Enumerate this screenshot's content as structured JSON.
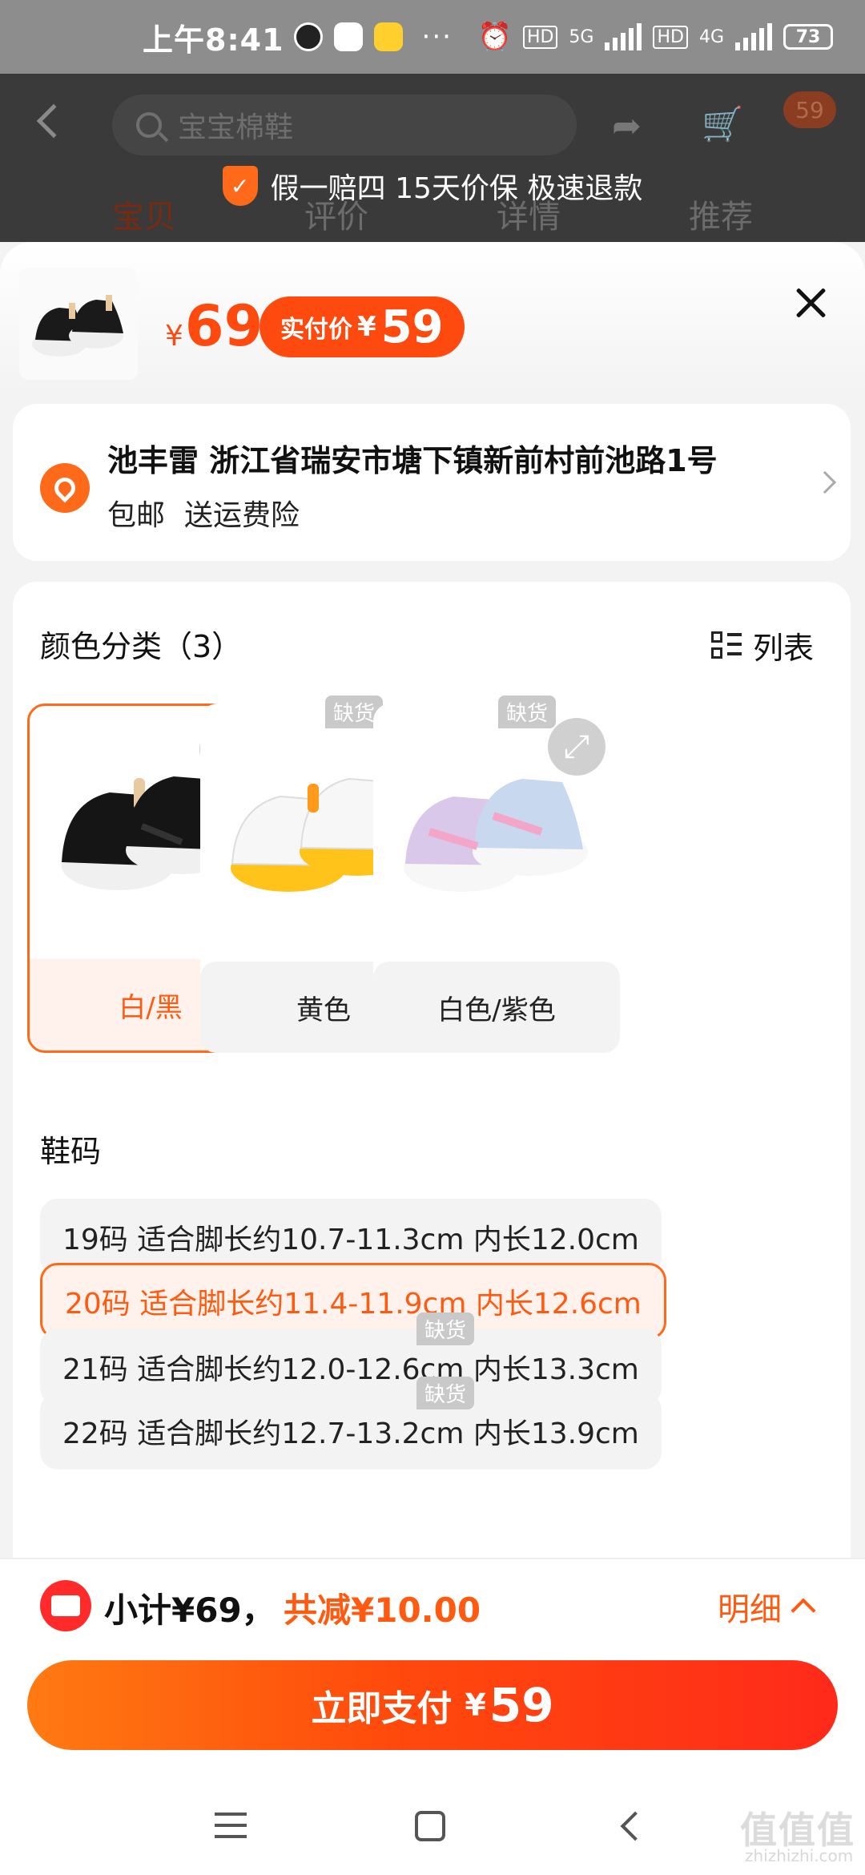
{
  "status_bar": {
    "time": "上午8:41",
    "dots": "···",
    "network_1": "5G",
    "network_2": "4G",
    "hd": "HD",
    "battery": "73"
  },
  "header": {
    "search_text": "宝宝棉鞋",
    "cart_count": "59",
    "guarantee": "假一赔四 15天价保 极速退款",
    "tabs": [
      "宝贝",
      "评价",
      "详情",
      "推荐"
    ]
  },
  "sheet": {
    "price_currency": "¥",
    "price": "69",
    "pay_label": "实付价",
    "pay_currency": "¥",
    "pay_price": "59",
    "address": "池丰雷 浙江省瑞安市塘下镇新前村前池路1号",
    "shipping": [
      "包邮",
      "送运费险"
    ],
    "color_section_title": "颜色分类（3）",
    "list_toggle_label": "列表",
    "colors": [
      {
        "label": "白/黑",
        "selected": true,
        "out_of_stock": false
      },
      {
        "label": "黄色",
        "selected": false,
        "out_of_stock": true
      },
      {
        "label": "白色/紫色",
        "selected": false,
        "out_of_stock": true
      }
    ],
    "oos_label": "缺货",
    "size_section_title": "鞋码",
    "sizes": [
      {
        "label": "19码  适合脚长约10.7-11.3cm 内长12.0cm",
        "selected": false,
        "out_of_stock": false
      },
      {
        "label": "20码  适合脚长约11.4-11.9cm 内长12.6cm",
        "selected": true,
        "out_of_stock": false
      },
      {
        "label": "21码  适合脚长约12.0-12.6cm 内长13.3cm",
        "selected": false,
        "out_of_stock": true
      },
      {
        "label": "22码  适合脚长约12.7-13.2cm 内长13.9cm",
        "selected": false,
        "out_of_stock": true
      }
    ]
  },
  "bottom": {
    "subtotal": "小计¥69，",
    "discount": "共减¥10.00",
    "detail_label": "明细",
    "pay_label": "立即支付",
    "pay_currency": "¥",
    "pay_amount": "59"
  },
  "watermark": {
    "text": "值值值",
    "sub": "zhizhizhi.com"
  },
  "colors": {
    "accent": "#ff5a10",
    "accent_light": "#fff1eb",
    "oos_tag": "#c9c9c9"
  }
}
